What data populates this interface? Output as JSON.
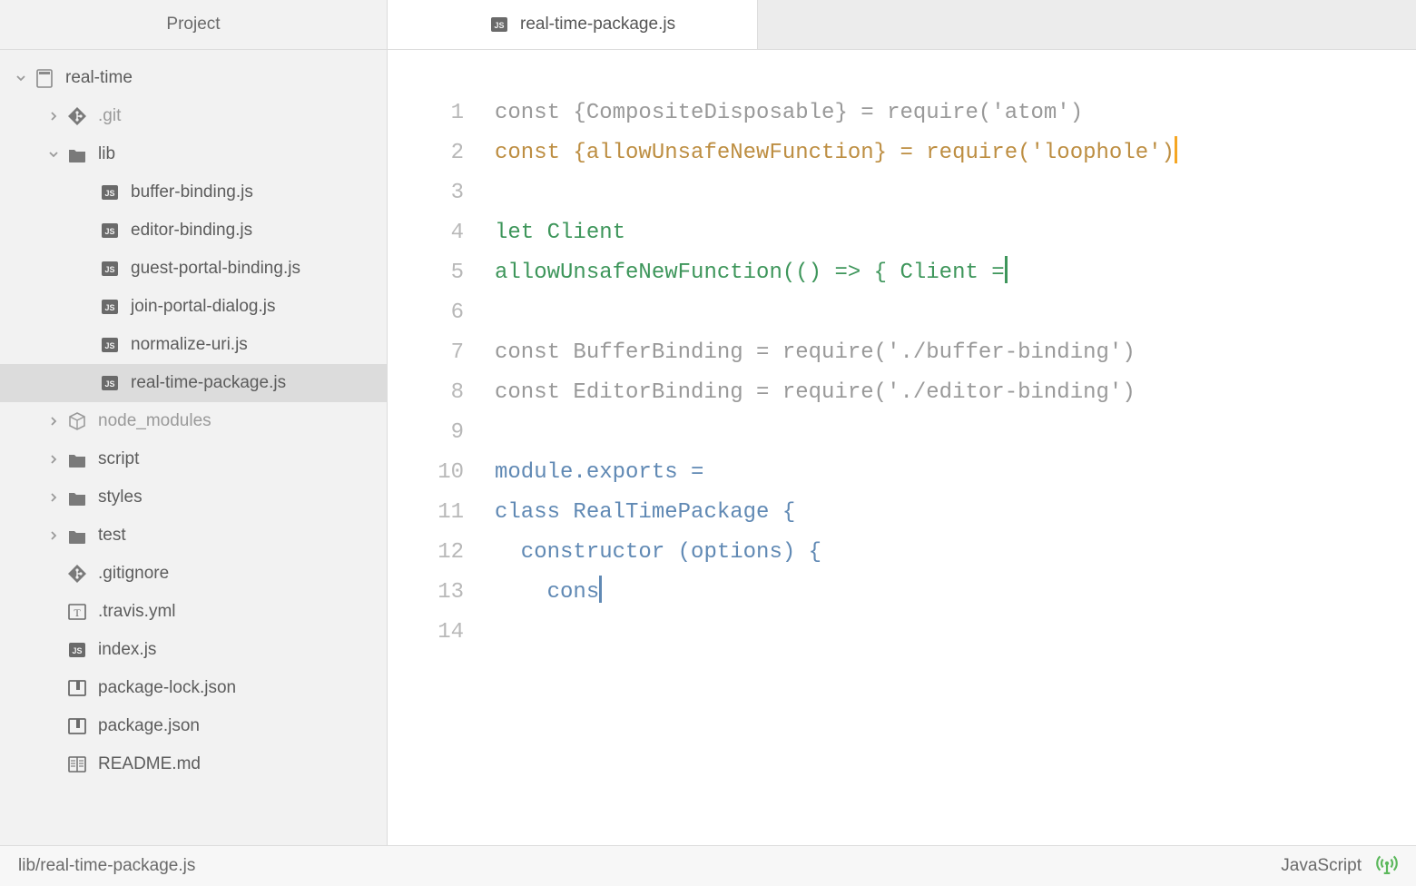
{
  "sidebar": {
    "header": "Project",
    "tree": [
      {
        "depth": 0,
        "chev": "down",
        "icon": "repo",
        "label": "real-time",
        "dim": false,
        "selected": false
      },
      {
        "depth": 1,
        "chev": "right",
        "icon": "git",
        "label": ".git",
        "dim": true,
        "selected": false
      },
      {
        "depth": 1,
        "chev": "down",
        "icon": "folder",
        "label": "lib",
        "dim": false,
        "selected": false
      },
      {
        "depth": 2,
        "chev": "none",
        "icon": "js",
        "label": "buffer-binding.js",
        "dim": false,
        "selected": false
      },
      {
        "depth": 2,
        "chev": "none",
        "icon": "js",
        "label": "editor-binding.js",
        "dim": false,
        "selected": false
      },
      {
        "depth": 2,
        "chev": "none",
        "icon": "js",
        "label": "guest-portal-binding.js",
        "dim": false,
        "selected": false
      },
      {
        "depth": 2,
        "chev": "none",
        "icon": "js",
        "label": "join-portal-dialog.js",
        "dim": false,
        "selected": false
      },
      {
        "depth": 2,
        "chev": "none",
        "icon": "js",
        "label": "normalize-uri.js",
        "dim": false,
        "selected": false
      },
      {
        "depth": 2,
        "chev": "none",
        "icon": "js",
        "label": "real-time-package.js",
        "dim": false,
        "selected": true
      },
      {
        "depth": 1,
        "chev": "right",
        "icon": "module",
        "label": "node_modules",
        "dim": true,
        "selected": false
      },
      {
        "depth": 1,
        "chev": "right",
        "icon": "folder",
        "label": "script",
        "dim": false,
        "selected": false
      },
      {
        "depth": 1,
        "chev": "right",
        "icon": "folder",
        "label": "styles",
        "dim": false,
        "selected": false
      },
      {
        "depth": 1,
        "chev": "right",
        "icon": "folder",
        "label": "test",
        "dim": false,
        "selected": false
      },
      {
        "depth": 1,
        "chev": "none",
        "icon": "git",
        "label": ".gitignore",
        "dim": false,
        "selected": false
      },
      {
        "depth": 1,
        "chev": "none",
        "icon": "travis",
        "label": ".travis.yml",
        "dim": false,
        "selected": false
      },
      {
        "depth": 1,
        "chev": "none",
        "icon": "js",
        "label": "index.js",
        "dim": false,
        "selected": false
      },
      {
        "depth": 1,
        "chev": "none",
        "icon": "npm",
        "label": "package-lock.json",
        "dim": false,
        "selected": false
      },
      {
        "depth": 1,
        "chev": "none",
        "icon": "npm",
        "label": "package.json",
        "dim": false,
        "selected": false
      },
      {
        "depth": 1,
        "chev": "none",
        "icon": "book",
        "label": "README.md",
        "dim": false,
        "selected": false
      }
    ]
  },
  "tabs": [
    {
      "icon": "js",
      "label": "real-time-package.js",
      "active": true
    }
  ],
  "code": {
    "line_count": 14,
    "lines": [
      [
        {
          "cls": "tok-gray",
          "text": "const {CompositeDisposable} = require('atom')"
        }
      ],
      [
        {
          "cls": "tok-brown",
          "text": "const {allowUnsafeNewFunction} = require('loophole')"
        },
        {
          "cursor": "orange"
        }
      ],
      [],
      [
        {
          "cls": "tok-green",
          "text": "let Client"
        }
      ],
      [
        {
          "cls": "tok-green",
          "text": "allowUnsafeNewFunction(() => { Client ="
        },
        {
          "cursor": "green"
        }
      ],
      [],
      [
        {
          "cls": "tok-gray",
          "text": "const BufferBinding = require('./buffer-binding')"
        }
      ],
      [
        {
          "cls": "tok-gray",
          "text": "const EditorBinding = require('./editor-binding')"
        }
      ],
      [],
      [
        {
          "cls": "tok-blue",
          "text": "module.exports ="
        }
      ],
      [
        {
          "cls": "tok-blue",
          "text": "class RealTimePackage {"
        }
      ],
      [
        {
          "cls": "tok-blue",
          "text": "  constructor (options) {"
        }
      ],
      [
        {
          "cls": "tok-blue",
          "text": "    cons"
        },
        {
          "cursor": "blue"
        }
      ],
      []
    ]
  },
  "status": {
    "path": "lib/real-time-package.js",
    "grammar": "JavaScript"
  }
}
